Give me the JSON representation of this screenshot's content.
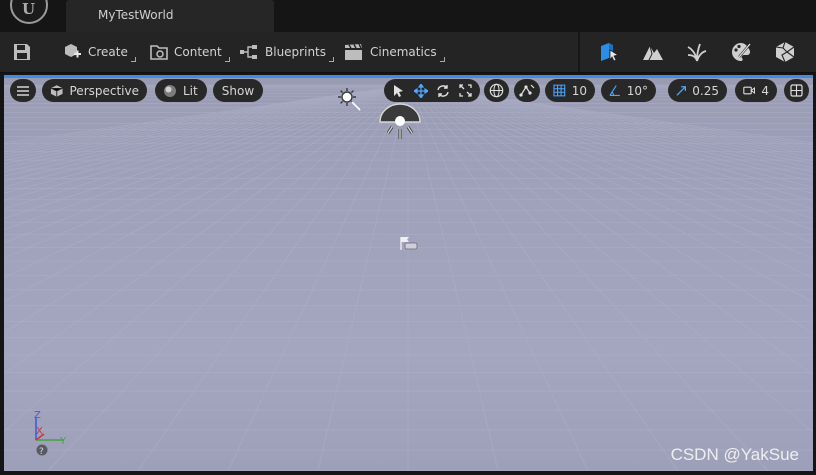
{
  "window": {
    "document_tab": "MyTestWorld"
  },
  "toolbar": {
    "create_label": "Create",
    "content_label": "Content",
    "blueprints_label": "Blueprints",
    "cinematics_label": "Cinematics",
    "modes": [
      "select-mode-icon",
      "landscape-mode-icon",
      "foliage-mode-icon",
      "mesh-paint-mode-icon",
      "fracture-mode-icon"
    ]
  },
  "viewport": {
    "view_mode": "Perspective",
    "lighting_mode": "Lit",
    "show_label": "Show",
    "grid_snap": "10",
    "rotation_snap": "10°",
    "scale_snap": "0.25",
    "camera_speed": "4",
    "axis": {
      "z": "Z",
      "x": "X",
      "y": "Y"
    }
  },
  "watermark": "CSDN @YakSue",
  "colors": {
    "accent": "#3d8ee0",
    "viewport_bg": "#a0a2bc",
    "toolbar_bg": "#242424"
  }
}
